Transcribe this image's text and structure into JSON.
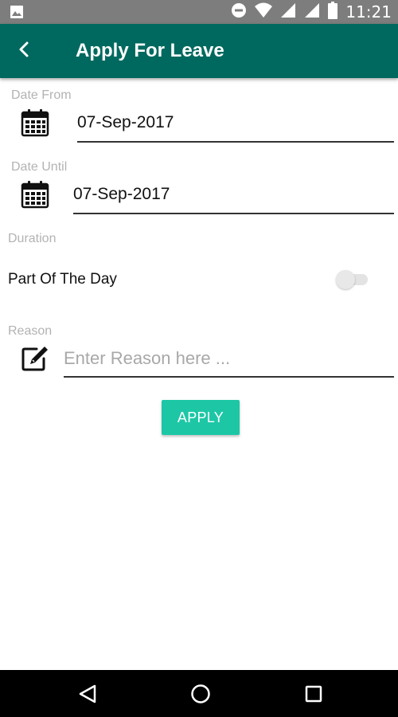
{
  "status_bar": {
    "time": "11:21",
    "icons": [
      "image-icon",
      "do-not-disturb-icon",
      "wifi-icon",
      "cellular-signal-icon",
      "cellular-signal-icon",
      "battery-icon"
    ]
  },
  "app_bar": {
    "title": "Apply For Leave",
    "back_icon": "chevron-left-icon"
  },
  "form": {
    "date_from": {
      "caption": "Date From",
      "value": "07-Sep-2017",
      "icon": "calendar-icon"
    },
    "date_until": {
      "caption": "Date Until",
      "value": "07-Sep-2017",
      "icon": "calendar-icon"
    },
    "duration": {
      "caption": "Duration",
      "part_of_day_label": "Part Of The Day",
      "part_of_day_on": false
    },
    "reason": {
      "caption": "Reason",
      "value": "",
      "placeholder": "Enter Reason here ...",
      "icon": "edit-icon"
    },
    "apply_label": "APPLY"
  },
  "nav_bar": {
    "icons": [
      "back-triangle-icon",
      "home-circle-icon",
      "recents-square-icon"
    ]
  },
  "colors": {
    "app_bar": "#00695f",
    "status_bar": "#7d7d7d",
    "apply_button": "#1dc7a6",
    "caption": "#b3b3b3"
  }
}
